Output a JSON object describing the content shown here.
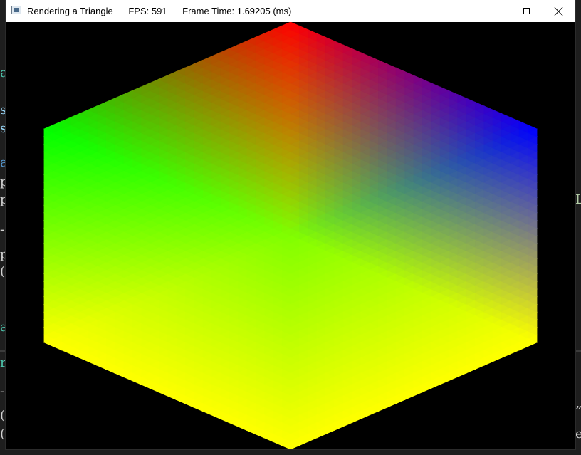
{
  "window": {
    "title": "Rendering a Triangle",
    "fps_label": "FPS: 591",
    "frame_time_label": "Frame Time: 1.69205 (ms)"
  },
  "hexagon_colors": {
    "top": "#ff0000",
    "upper_right": "#0000ff",
    "lower_right": "#ffff00",
    "bottom": "#ffff00",
    "lower_left": "#ffff00",
    "upper_left": "#00ff00",
    "center": "#80ff00"
  },
  "background_editor": {
    "glyphs": [
      "a",
      "s",
      "s",
      "a",
      "p",
      "p",
      "-",
      "p",
      "(",
      "a",
      "m",
      "-",
      "(",
      "(",
      "L",
      "”",
      "e"
    ]
  }
}
